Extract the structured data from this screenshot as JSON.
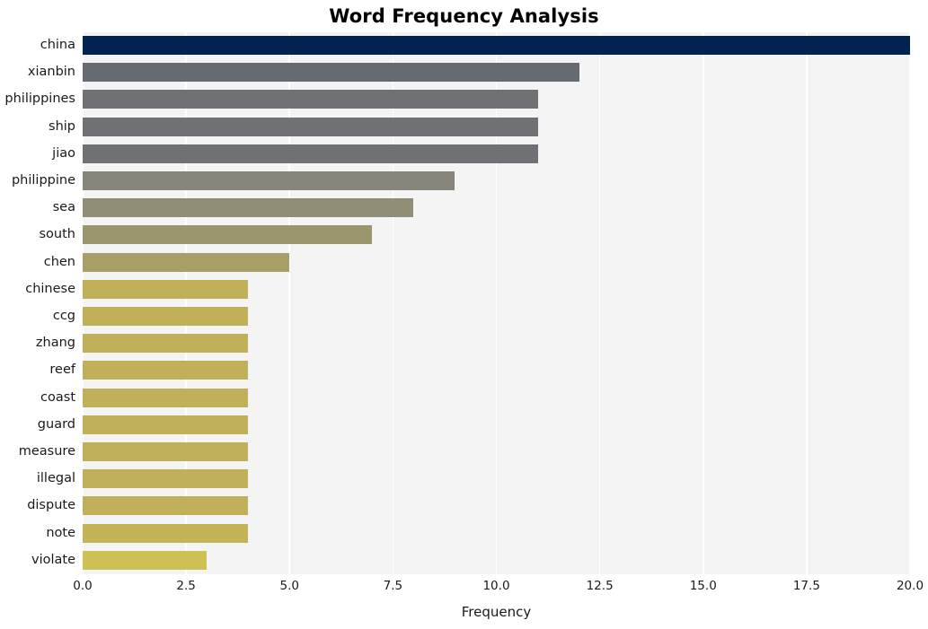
{
  "chart_data": {
    "type": "bar",
    "orientation": "horizontal",
    "title": "Word Frequency Analysis",
    "xlabel": "Frequency",
    "ylabel": "",
    "xlim": [
      0,
      20
    ],
    "ylim": null,
    "grid": true,
    "legend": null,
    "xticks": [
      "0.0",
      "2.5",
      "5.0",
      "7.5",
      "10.0",
      "12.5",
      "15.0",
      "17.5",
      "20.0"
    ],
    "xtick_values": [
      0,
      2.5,
      5,
      7.5,
      10,
      12.5,
      15,
      17.5,
      20
    ],
    "categories": [
      "china",
      "xianbin",
      "philippines",
      "ship",
      "jiao",
      "philippine",
      "sea",
      "south",
      "chen",
      "chinese",
      "ccg",
      "zhang",
      "reef",
      "coast",
      "guard",
      "measure",
      "illegal",
      "dispute",
      "note",
      "violate"
    ],
    "values": [
      20,
      12,
      11,
      11,
      11,
      9,
      8,
      7,
      5,
      4,
      4,
      4,
      4,
      4,
      4,
      4,
      4,
      4,
      4,
      3
    ],
    "bar_colors": [
      "#00234f",
      "#666a73",
      "#6f7175",
      "#6f7175",
      "#6f7175",
      "#878579",
      "#918e77",
      "#9c9670",
      "#a89e68",
      "#c0b059",
      "#c0b059",
      "#c0b059",
      "#c0b059",
      "#c0b059",
      "#c0b059",
      "#c0b059",
      "#c0b059",
      "#c0b059",
      "#c4b457",
      "#cfc254"
    ],
    "colormap": "cividis",
    "plot_background": "#f4f4f5",
    "gridline_color": "#ffffff",
    "text_color": "#1a1a1a"
  }
}
